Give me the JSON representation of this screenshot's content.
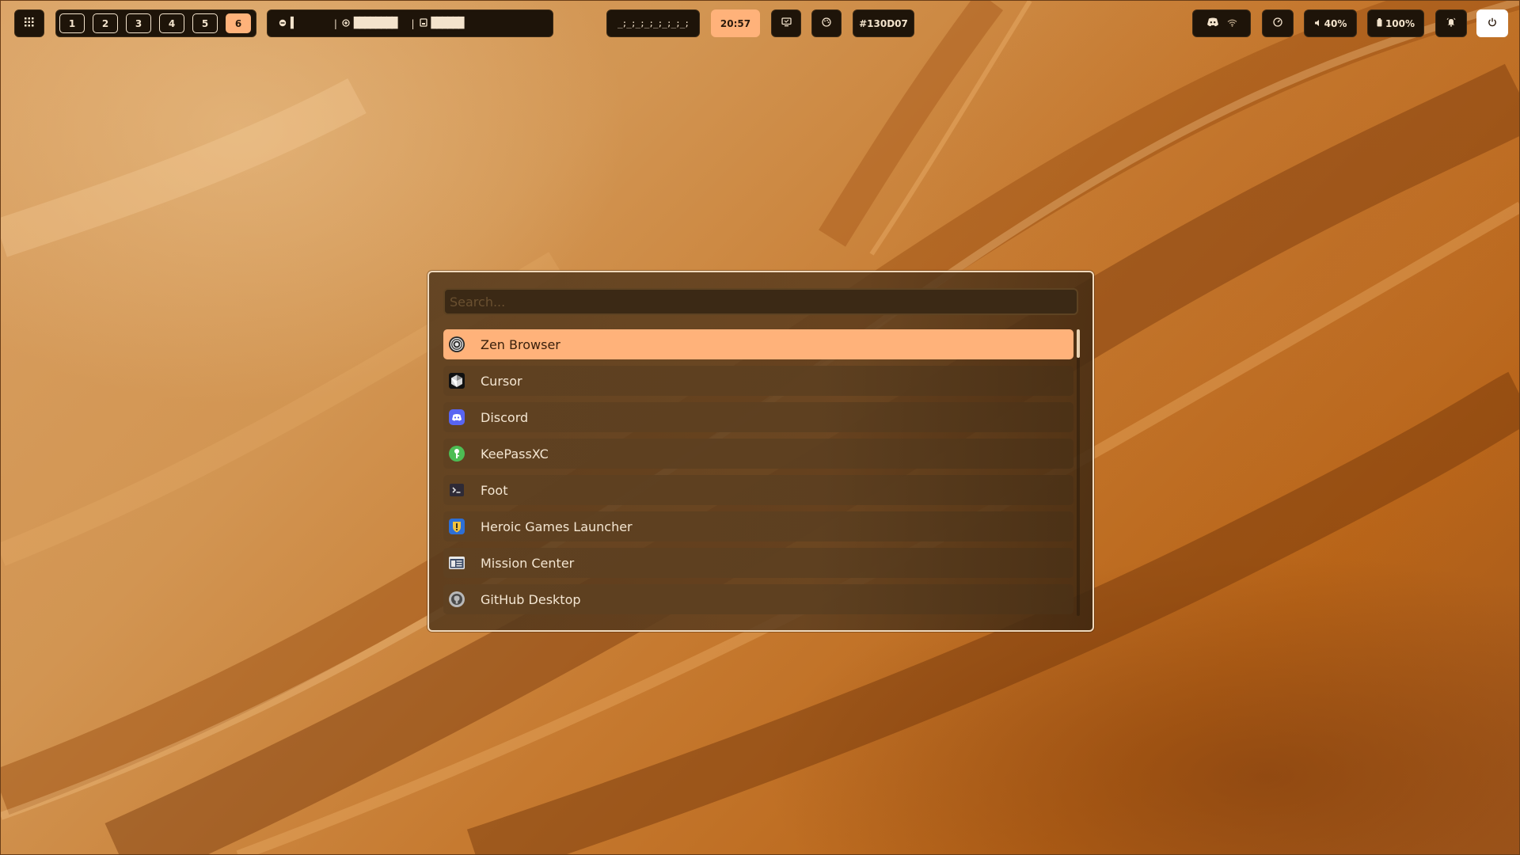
{
  "topbar": {
    "apps_menu_icon": "grid-icon",
    "workspaces": [
      {
        "label": "1",
        "active": false
      },
      {
        "label": "2",
        "active": false
      },
      {
        "label": "3",
        "active": false
      },
      {
        "label": "4",
        "active": false
      },
      {
        "label": "5",
        "active": false
      },
      {
        "label": "6",
        "active": true
      }
    ],
    "system_stats": [
      {
        "icon": "cpu-icon",
        "bar": "▌"
      },
      {
        "icon": "memory-icon",
        "bar": "████████"
      },
      {
        "icon": "disk-icon",
        "bar": "██████"
      }
    ],
    "stat_separator": "|",
    "visualizer": "_;_;_;_;_;_;_;_;",
    "clock": "20:57",
    "screen_icon": "monitor-icon",
    "palette_icon": "palette-icon",
    "color_hex": "#130D07",
    "tray_icons": [
      "discord-icon",
      "wifi-icon"
    ],
    "performance_icon": "speedometer-icon",
    "volume": {
      "icon": "speaker-icon",
      "label": "40%"
    },
    "battery": {
      "icon": "battery-icon",
      "label": "100%"
    },
    "notifications_icon": "bell-icon",
    "power_icon": "power-icon"
  },
  "launcher": {
    "search_placeholder": "Search...",
    "search_value": "",
    "apps": [
      {
        "label": "Zen Browser",
        "icon": "zen-browser-icon",
        "selected": true
      },
      {
        "label": "Cursor",
        "icon": "cursor-icon",
        "selected": false
      },
      {
        "label": "Discord",
        "icon": "discord-icon",
        "selected": false
      },
      {
        "label": "KeePassXC",
        "icon": "keepassxc-icon",
        "selected": false
      },
      {
        "label": "Foot",
        "icon": "terminal-icon",
        "selected": false
      },
      {
        "label": "Heroic Games Launcher",
        "icon": "heroic-icon",
        "selected": false
      },
      {
        "label": "Mission Center",
        "icon": "mission-center-icon",
        "selected": false
      },
      {
        "label": "GitHub Desktop",
        "icon": "github-icon",
        "selected": false
      }
    ]
  },
  "colors": {
    "accent": "#ffb27a",
    "bar_bg": "#1e1409",
    "text_light": "#f3e3cc",
    "launcher_border": "#f0d9bc"
  }
}
